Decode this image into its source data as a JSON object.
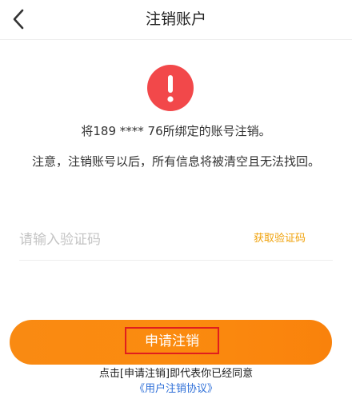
{
  "header": {
    "title": "注销账户",
    "back_icon": "chevron-left-icon"
  },
  "notice": {
    "icon": "exclamation-circle-icon",
    "icon_color": "#f2484a",
    "line1": "将189 **** 76所绑定的账号注销。",
    "line2": "注意，注销账号以后，所有信息将被清空且无法找回。"
  },
  "verification": {
    "input_placeholder": "请输入验证码",
    "input_value": "",
    "get_code_label": "获取验证码"
  },
  "action": {
    "apply_label": "申请注销",
    "button_color": "#fa8a10",
    "highlight_color": "#e01e1e"
  },
  "footer": {
    "agree_text": "点击[申请注销]即代表你已经同意",
    "agreement_link": "《用户注销协议》"
  }
}
